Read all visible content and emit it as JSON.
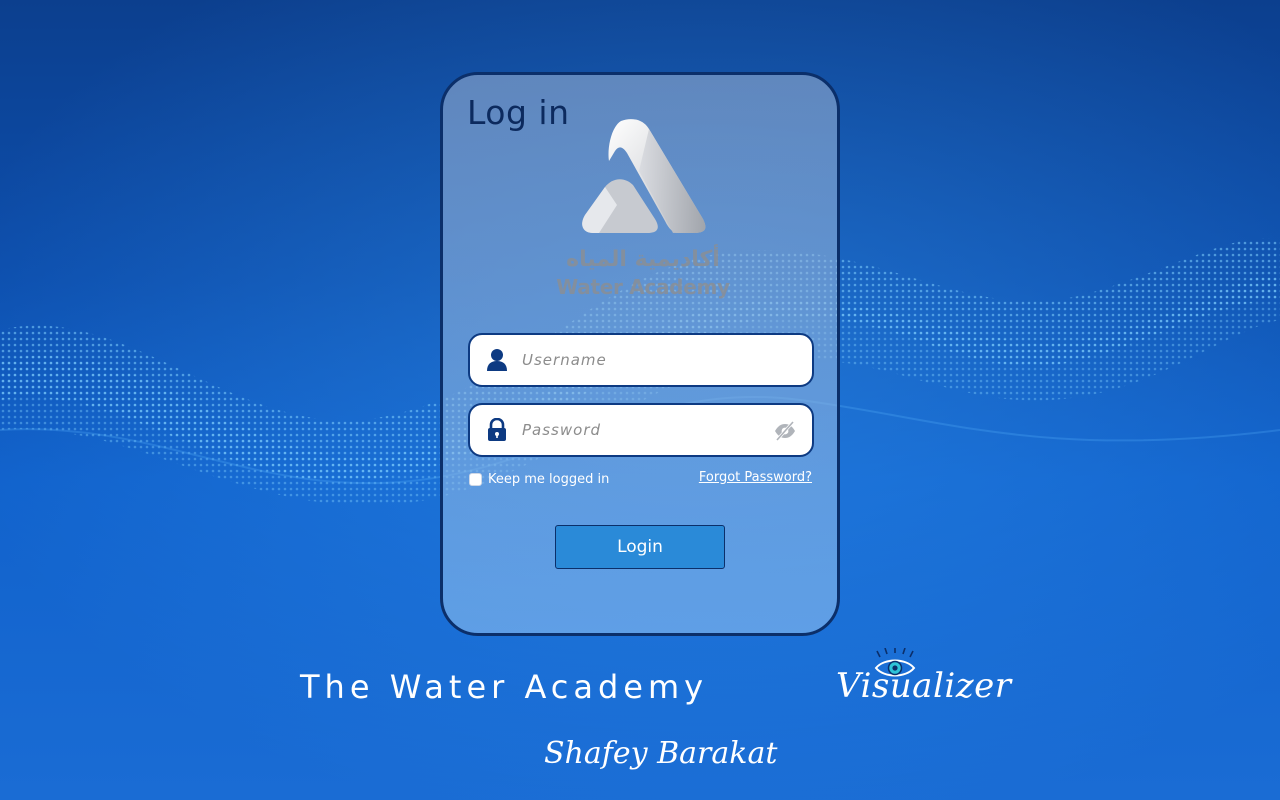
{
  "colors": {
    "background": "#0d4fae",
    "card_border": "#0b2f6a",
    "button": "#2a8ad8",
    "title": "#0c2a5e"
  },
  "login_card": {
    "title": "Log in",
    "logo": {
      "icon": "water-academy-logo",
      "name_ar": "أكاديمية المياه",
      "name_en": "Water Academy"
    },
    "username": {
      "placeholder": "Username",
      "value": "",
      "icon": "user-icon"
    },
    "password": {
      "placeholder": "Password",
      "value": "",
      "icon": "lock-icon",
      "toggle_icon": "eye-slash-icon"
    },
    "remember_label": "Keep me logged in",
    "forgot_label": "Forgot Password?",
    "login_label": "Login"
  },
  "footer": {
    "brand": "The Water Academy",
    "visualizer": "Visualizer",
    "signature": "Shafey Barakat"
  }
}
